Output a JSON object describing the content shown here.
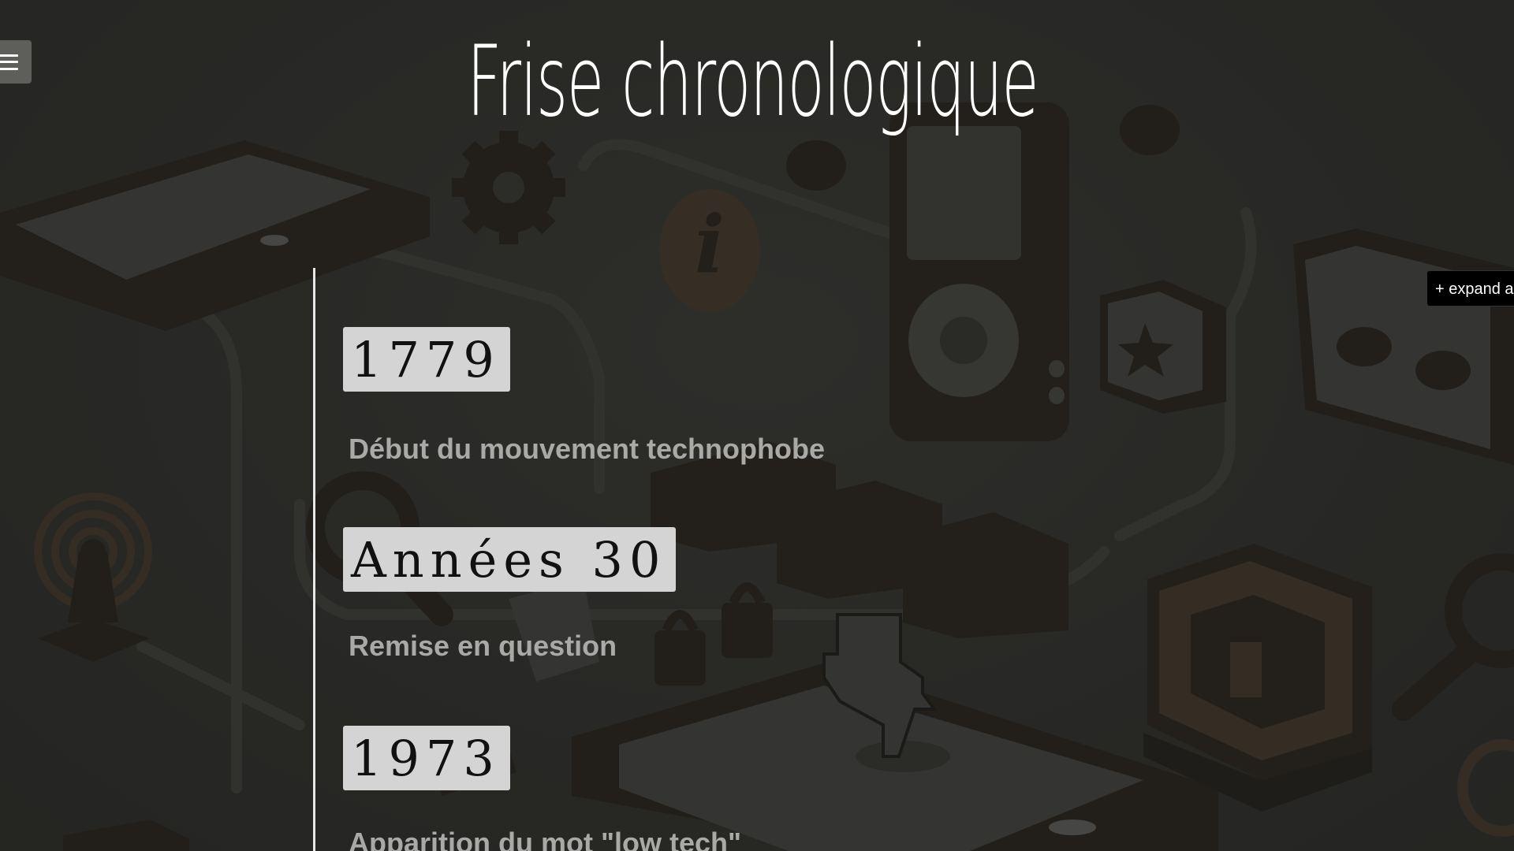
{
  "page": {
    "title": "Frise chronologique",
    "expand_label": "+ expand a"
  },
  "timeline": {
    "events": [
      {
        "date": "1779",
        "description": "Début du mouvement technophobe"
      },
      {
        "date": "Années 30",
        "description": "Remise en question"
      },
      {
        "date": "1973",
        "description": "Apparition du mot \"low tech\""
      }
    ]
  },
  "icons": {
    "menu": "hamburger-icon"
  },
  "colors": {
    "background": "#2a2b28",
    "badge": "#d4d4d4",
    "description_text": "#a9a9a7",
    "title": "#ffffff"
  }
}
